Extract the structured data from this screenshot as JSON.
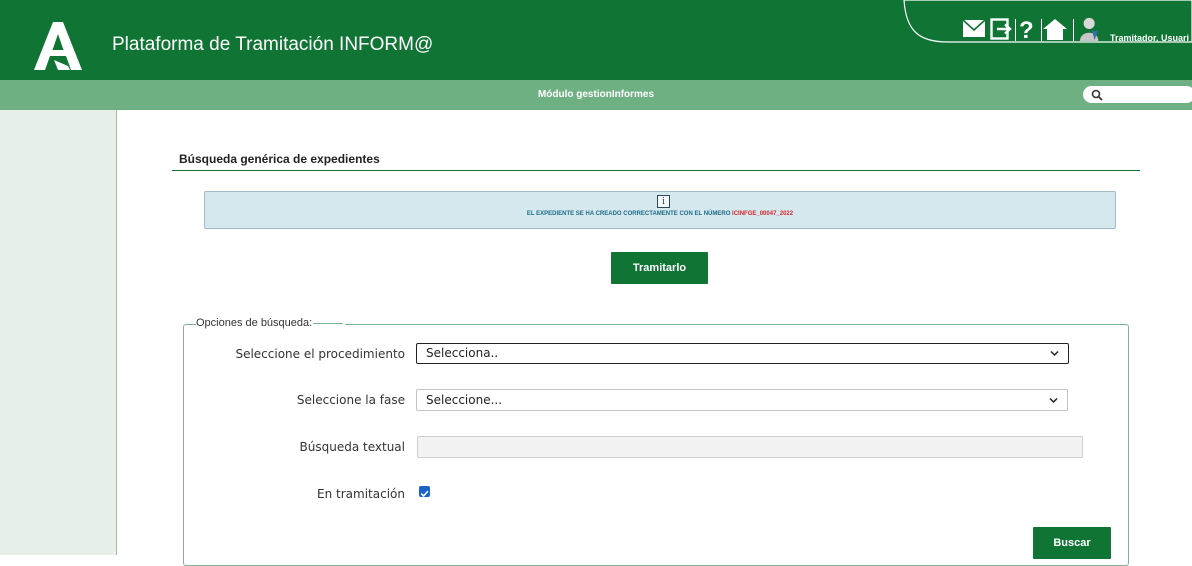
{
  "header": {
    "app_title": "Plataforma de Tramitación INFORM@",
    "user_name": "Tramitador, Usuari"
  },
  "toolbar": {
    "icons": [
      "mail-icon",
      "logout-icon",
      "help-icon",
      "home-icon",
      "user-icon"
    ]
  },
  "module_bar": {
    "title": "Módulo gestionInformes"
  },
  "section": {
    "title": "Búsqueda genérica de expedientes"
  },
  "info": {
    "icon_glyph": "i",
    "message": "EL EXPEDIENTE SE HA CREADO CORRECTAMENTE CON EL NÚMERO ",
    "number": "ICINFGE_00047_2022"
  },
  "actions": {
    "tramitarlo_label": "Tramitarlo",
    "buscar_label": "Buscar"
  },
  "search_options": {
    "legend": "Opciones de búsqueda:",
    "procedimiento": {
      "label": "Seleccione el procedimiento",
      "value": "Selecciona.."
    },
    "fase": {
      "label": "Seleccione la fase",
      "value": "Seleccione..."
    },
    "textual": {
      "label": "Búsqueda textual",
      "value": ""
    },
    "en_tramitacion": {
      "label": "En tramitación",
      "checked": true
    }
  },
  "colors": {
    "brand_green": "#0f7434",
    "module_bar": "#6fb083",
    "info_bg": "#d5e8ee",
    "highlight_red": "#d6262a"
  }
}
